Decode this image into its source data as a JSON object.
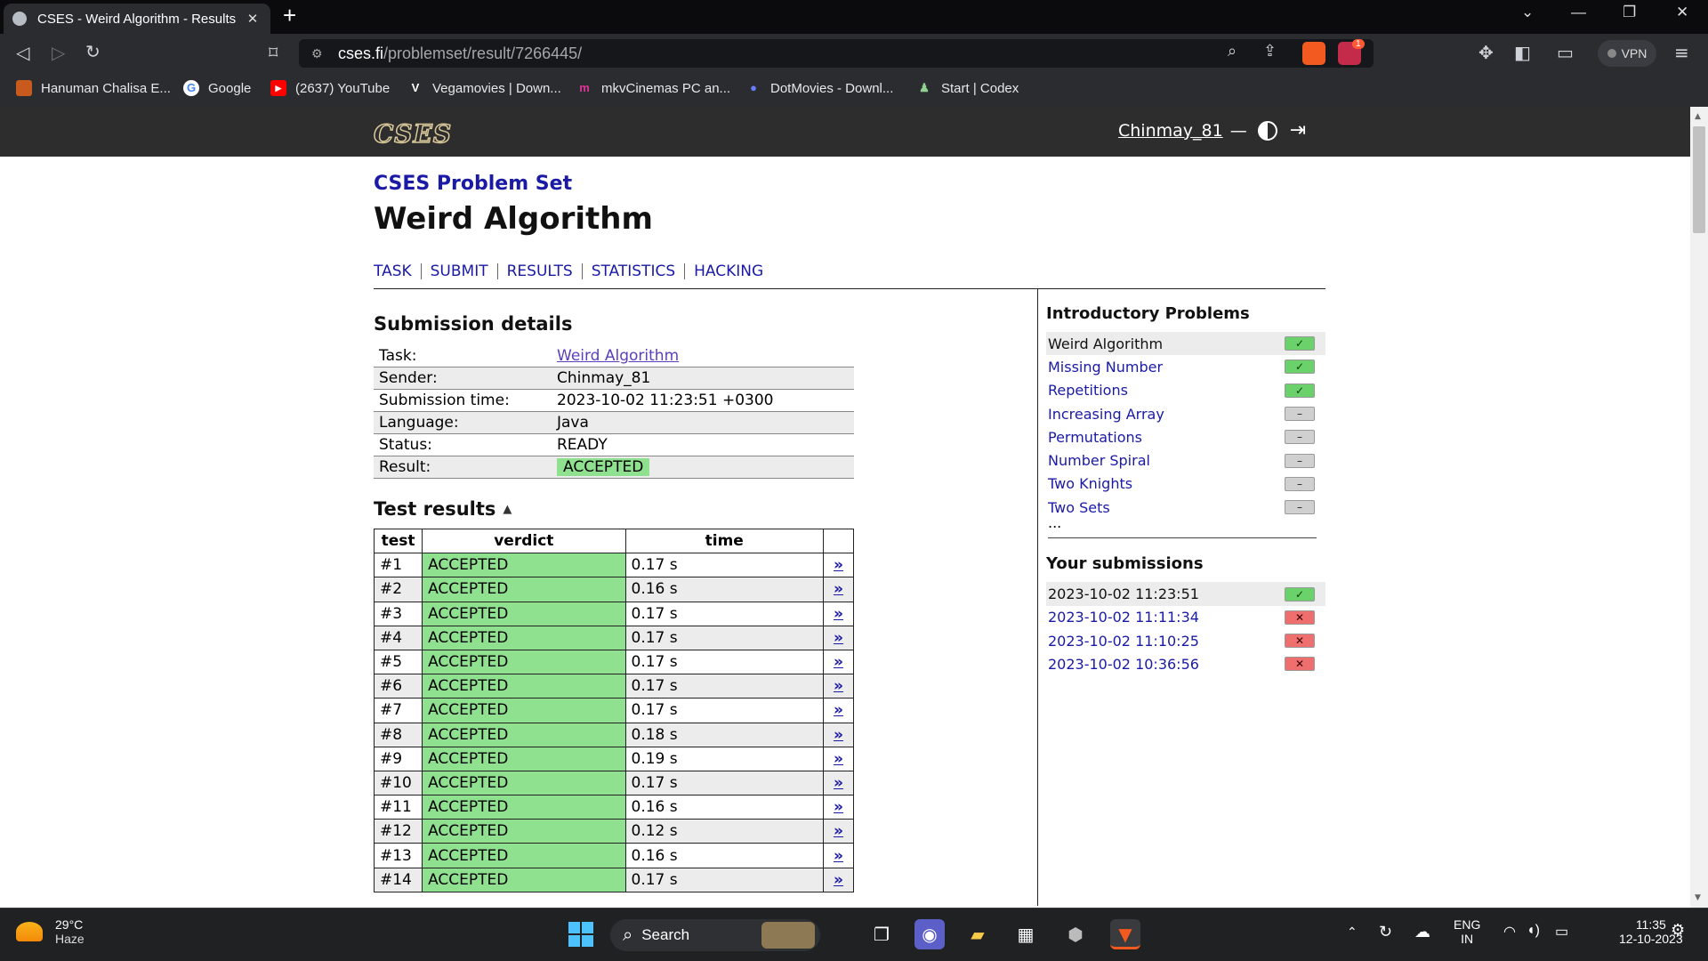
{
  "browser": {
    "tab_title": "CSES - Weird Algorithm - Results",
    "url_host": "cses.fi",
    "url_path": "/problemset/result/7266445/",
    "brave_badge": "1",
    "vpn_label": "VPN",
    "bookmarks": [
      {
        "label": "Hanuman Chalisa E...",
        "icon": "hanuman-icon"
      },
      {
        "label": "Google",
        "icon": "google-icon"
      },
      {
        "label": "(2637) YouTube",
        "icon": "youtube-icon"
      },
      {
        "label": "Vegamovies | Down...",
        "icon": "vegamovies-icon"
      },
      {
        "label": "mkvCinemas PC an...",
        "icon": "mkvcinemas-icon"
      },
      {
        "label": "DotMovies - Downl...",
        "icon": "dotmovies-icon"
      },
      {
        "label": "Start | Codex",
        "icon": "codex-icon"
      }
    ]
  },
  "site": {
    "logo": "CSES",
    "username": "Chinmay_81",
    "separator": "—"
  },
  "page": {
    "breadcrumb": "CSES Problem Set",
    "title": "Weird Algorithm",
    "nav": [
      "TASK",
      "SUBMIT",
      "RESULTS",
      "STATISTICS",
      "HACKING"
    ]
  },
  "details": {
    "heading": "Submission details",
    "rows": [
      {
        "label": "Task:",
        "value": "Weird Algorithm"
      },
      {
        "label": "Sender:",
        "value": "Chinmay_81"
      },
      {
        "label": "Submission time:",
        "value": "2023-10-02 11:23:51 +0300"
      },
      {
        "label": "Language:",
        "value": "Java"
      },
      {
        "label": "Status:",
        "value": "READY"
      },
      {
        "label": "Result:",
        "value": "ACCEPTED"
      }
    ]
  },
  "tests": {
    "heading": "Test results",
    "headers": [
      "test",
      "verdict",
      "time",
      ""
    ],
    "more_glyph": "»",
    "rows": [
      {
        "test": "#1",
        "verdict": "ACCEPTED",
        "time": "0.17 s"
      },
      {
        "test": "#2",
        "verdict": "ACCEPTED",
        "time": "0.16 s"
      },
      {
        "test": "#3",
        "verdict": "ACCEPTED",
        "time": "0.17 s"
      },
      {
        "test": "#4",
        "verdict": "ACCEPTED",
        "time": "0.17 s"
      },
      {
        "test": "#5",
        "verdict": "ACCEPTED",
        "time": "0.17 s"
      },
      {
        "test": "#6",
        "verdict": "ACCEPTED",
        "time": "0.17 s"
      },
      {
        "test": "#7",
        "verdict": "ACCEPTED",
        "time": "0.17 s"
      },
      {
        "test": "#8",
        "verdict": "ACCEPTED",
        "time": "0.18 s"
      },
      {
        "test": "#9",
        "verdict": "ACCEPTED",
        "time": "0.19 s"
      },
      {
        "test": "#10",
        "verdict": "ACCEPTED",
        "time": "0.17 s"
      },
      {
        "test": "#11",
        "verdict": "ACCEPTED",
        "time": "0.16 s"
      },
      {
        "test": "#12",
        "verdict": "ACCEPTED",
        "time": "0.12 s"
      },
      {
        "test": "#13",
        "verdict": "ACCEPTED",
        "time": "0.16 s"
      },
      {
        "test": "#14",
        "verdict": "ACCEPTED",
        "time": "0.17 s"
      }
    ]
  },
  "sidebar": {
    "problems_heading": "Introductory Problems",
    "problems": [
      {
        "name": "Weird Algorithm",
        "status": "ok",
        "current": true
      },
      {
        "name": "Missing Number",
        "status": "ok",
        "current": false
      },
      {
        "name": "Repetitions",
        "status": "ok",
        "current": false
      },
      {
        "name": "Increasing Array",
        "status": "none",
        "current": false
      },
      {
        "name": "Permutations",
        "status": "none",
        "current": false
      },
      {
        "name": "Number Spiral",
        "status": "none",
        "current": false
      },
      {
        "name": "Two Knights",
        "status": "none",
        "current": false
      },
      {
        "name": "Two Sets",
        "status": "none",
        "current": false
      }
    ],
    "ellipsis": "...",
    "submissions_heading": "Your submissions",
    "submissions": [
      {
        "time": "2023-10-02 11:23:51",
        "status": "ok",
        "current": true
      },
      {
        "time": "2023-10-02 11:11:34",
        "status": "fail",
        "current": false
      },
      {
        "time": "2023-10-02 11:10:25",
        "status": "fail",
        "current": false
      },
      {
        "time": "2023-10-02 10:36:56",
        "status": "fail",
        "current": false
      }
    ]
  },
  "taskbar": {
    "temp": "29°C",
    "weather": "Haze",
    "search_label": "Search",
    "lang_top": "ENG",
    "lang_bottom": "IN",
    "time": "11:35",
    "date": "12-10-2023"
  },
  "colors": {
    "accepted": "#8fe08f",
    "link": "#1a1aa6",
    "header_bg": "#2d2d2d"
  }
}
